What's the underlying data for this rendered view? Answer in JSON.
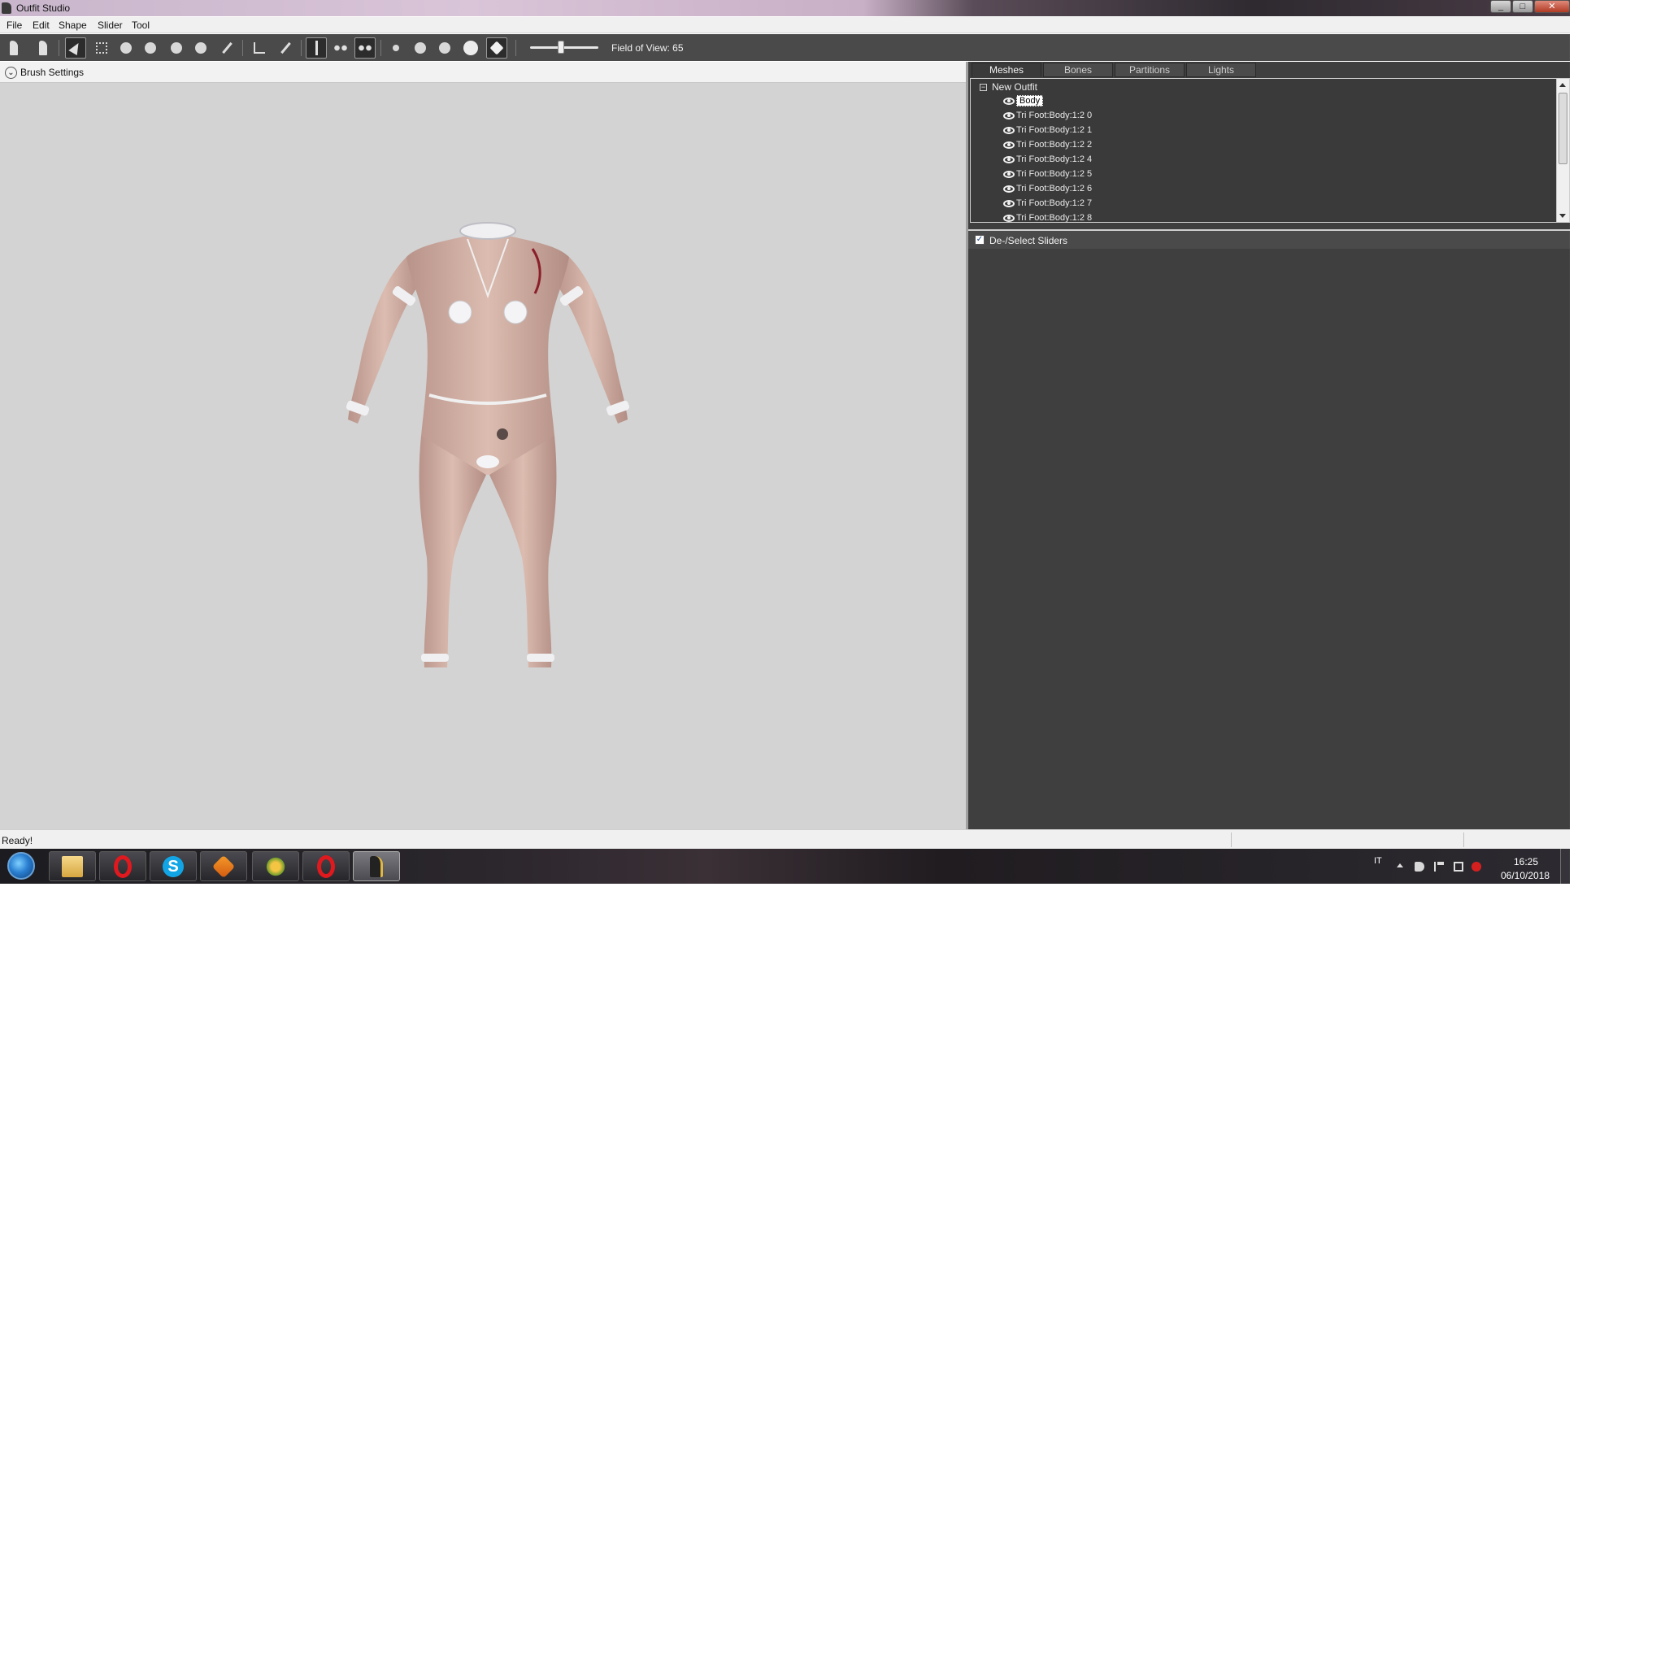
{
  "window": {
    "title": "Outfit Studio",
    "controls": [
      "_",
      "□",
      "✕"
    ]
  },
  "menu": [
    "File",
    "Edit",
    "Shape",
    "Slider",
    "Tool"
  ],
  "toolbar": {
    "fov_label": "Field of View: 65",
    "fov_value": 65
  },
  "viewport": {
    "brush_toggle": "⌄",
    "brush_label": "Brush Settings"
  },
  "tabs": [
    "Meshes",
    "Bones",
    "Partitions",
    "Lights"
  ],
  "active_tab": "Meshes",
  "tree": {
    "toggle": "−",
    "root": "New Outfit",
    "nodes": [
      "Body",
      "Tri Foot:Body:1:2 0",
      "Tri Foot:Body:1:2 1",
      "Tri Foot:Body:1:2 2",
      "Tri Foot:Body:1:2 4",
      "Tri Foot:Body:1:2 5",
      "Tri Foot:Body:1:2 6",
      "Tri Foot:Body:1:2 7",
      "Tri Foot:Body:1:2 8"
    ],
    "selected": "Body"
  },
  "sliders": {
    "label": "De-/Select Sliders",
    "checked": true,
    "check_glyph": "✓"
  },
  "status": {
    "text": "Ready!"
  },
  "taskbar": {
    "skype_glyph": "S",
    "lang": "IT",
    "time": "16:25",
    "date": "06/10/2018"
  },
  "colors": {
    "toolbar_bg": "#4a4a4a",
    "viewport_bg": "#d3d3d3",
    "panel_bg": "#3f3f3f",
    "skin": "#d6b4a6"
  }
}
